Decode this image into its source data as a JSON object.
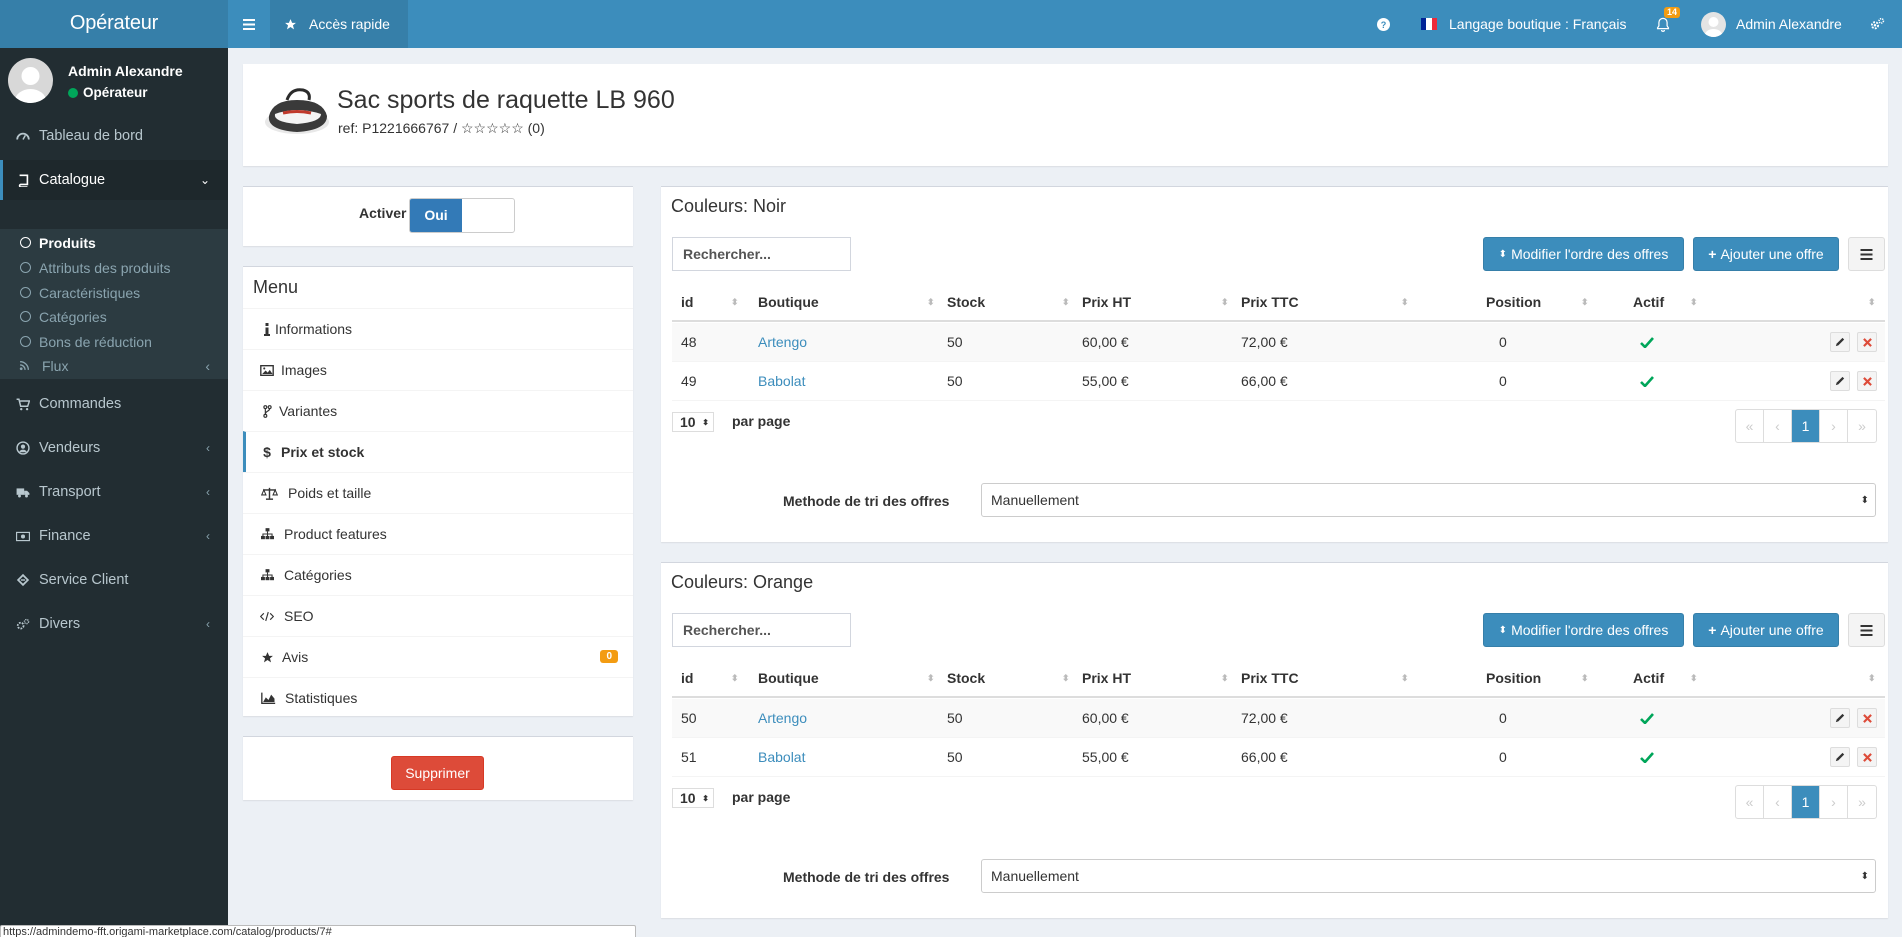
{
  "topbar": {
    "logo": "Opérateur",
    "quick_access": "Accès rapide",
    "language": "Langage boutique : Français",
    "notifications": "14",
    "user": "Admin Alexandre"
  },
  "sidebar": {
    "user_name": "Admin Alexandre",
    "user_role": "Opérateur",
    "items": [
      {
        "label": "Tableau de bord"
      },
      {
        "label": "Catalogue"
      },
      {
        "label": "Commandes"
      },
      {
        "label": "Vendeurs"
      },
      {
        "label": "Transport"
      },
      {
        "label": "Finance"
      },
      {
        "label": "Service Client"
      },
      {
        "label": "Divers"
      }
    ],
    "catalogue_sub": [
      {
        "label": "Produits"
      },
      {
        "label": "Attributs des produits"
      },
      {
        "label": "Caractéristiques"
      },
      {
        "label": "Catégories"
      },
      {
        "label": "Bons de réduction"
      },
      {
        "label": "Flux"
      }
    ]
  },
  "product": {
    "title": "Sac sports de raquette LB 960",
    "ref": "ref: P1221666767 / ☆☆☆☆☆ (0)"
  },
  "activate": {
    "label": "Activer",
    "on_label": "Oui"
  },
  "menu": {
    "title": "Menu",
    "items": [
      {
        "label": "Informations",
        "icon": "info-icon"
      },
      {
        "label": "Images",
        "icon": "image-icon"
      },
      {
        "label": "Variantes",
        "icon": "branch-icon"
      },
      {
        "label": "Prix et stock",
        "icon": "dollar-icon"
      },
      {
        "label": "Poids et taille",
        "icon": "scale-icon"
      },
      {
        "label": "Product features",
        "icon": "sitemap-icon"
      },
      {
        "label": "Catégories",
        "icon": "sitemap-icon"
      },
      {
        "label": "SEO",
        "icon": "code-icon"
      },
      {
        "label": "Avis",
        "icon": "star-icon"
      },
      {
        "label": "Statistiques",
        "icon": "area-chart-icon"
      }
    ],
    "avis_count": "0"
  },
  "delete_label": "Supprimer",
  "offers": {
    "search_placeholder": "Rechercher...",
    "order_label": "Modifier l'ordre des offres",
    "add_label": "Ajouter une offre",
    "columns": [
      "id",
      "Boutique",
      "Stock",
      "Prix HT",
      "Prix TTC",
      "Position",
      "Actif"
    ],
    "per_page": "10",
    "per_page_label": "par page",
    "page_current": "1",
    "sort_label": "Methode de tri des offres",
    "sort_value": "Manuellement",
    "groups": [
      {
        "title": "Couleurs: Noir",
        "rows": [
          {
            "id": "48",
            "shop": "Artengo",
            "stock": "50",
            "price_ht": "60,00 €",
            "price_ttc": "72,00 €",
            "position": "0"
          },
          {
            "id": "49",
            "shop": "Babolat",
            "stock": "50",
            "price_ht": "55,00 €",
            "price_ttc": "66,00 €",
            "position": "0"
          }
        ]
      },
      {
        "title": "Couleurs: Orange",
        "rows": [
          {
            "id": "50",
            "shop": "Artengo",
            "stock": "50",
            "price_ht": "60,00 €",
            "price_ttc": "72,00 €",
            "position": "0"
          },
          {
            "id": "51",
            "shop": "Babolat",
            "stock": "50",
            "price_ht": "55,00 €",
            "price_ttc": "66,00 €",
            "position": "0"
          }
        ]
      }
    ]
  },
  "statusbar_url": "https://admindemo-fft.origami-marketplace.com/catalog/products/7#",
  "colors": {
    "primary": "#3c8dbc",
    "sidebar": "#222d32",
    "danger": "#dd4b39",
    "success": "#00a65a",
    "warning": "#f39c12"
  }
}
